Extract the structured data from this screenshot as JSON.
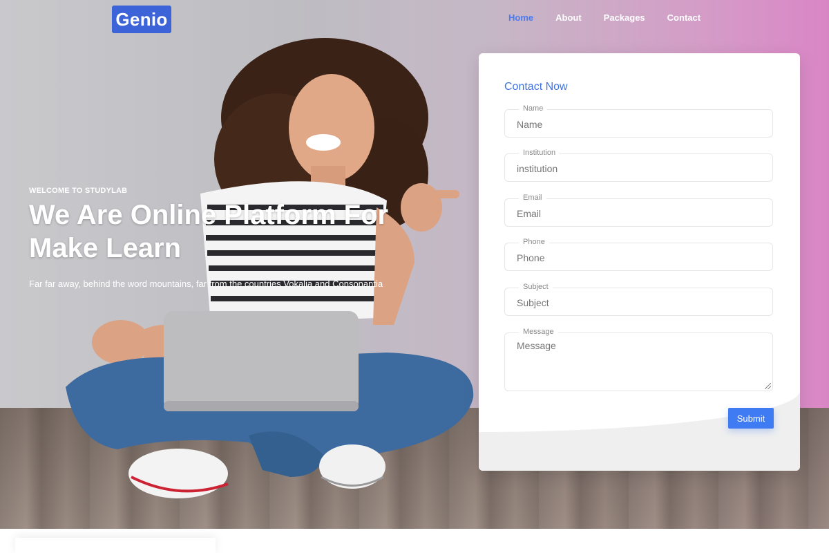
{
  "brand": {
    "logo_text": "Genio",
    "logo_color": "#3d63d8"
  },
  "nav": {
    "items": [
      {
        "label": "Home",
        "active": true
      },
      {
        "label": "About",
        "active": false
      },
      {
        "label": "Packages",
        "active": false
      },
      {
        "label": "Contact",
        "active": false
      }
    ],
    "active_color": "#4a7bf0"
  },
  "hero": {
    "subtitle": "WELCOME TO STUDYLAB",
    "title": "We Are Online Platform For Make Learn",
    "description": "Far far away, behind the word mountains, far from the countries Vokalia and Consonantia"
  },
  "contact_form": {
    "title": "Contact Now",
    "fields": {
      "name": {
        "label": "Name",
        "placeholder": "Name",
        "value": ""
      },
      "institution": {
        "label": "Institution",
        "placeholder": "institution",
        "value": ""
      },
      "email": {
        "label": "Email",
        "placeholder": "Email",
        "value": ""
      },
      "phone": {
        "label": "Phone",
        "placeholder": "Phone",
        "value": ""
      },
      "subject": {
        "label": "Subject",
        "placeholder": "Subject",
        "value": ""
      },
      "message": {
        "label": "Message",
        "placeholder": "Message",
        "value": ""
      }
    },
    "submit_label": "Submit",
    "accent_color": "#3f7bf3"
  }
}
